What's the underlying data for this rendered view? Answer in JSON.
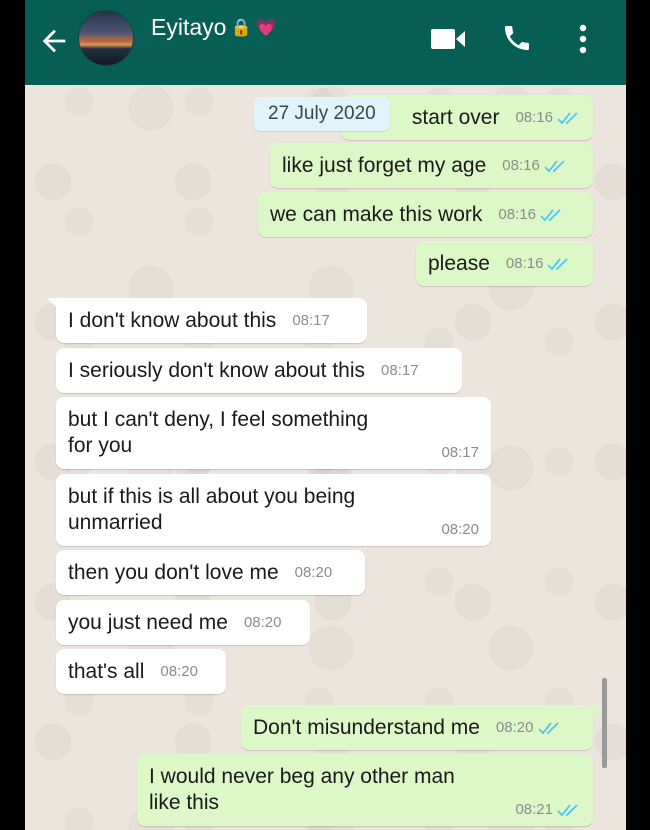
{
  "header": {
    "contact_name": "Eyitayo",
    "emoji_lock": "🔒",
    "emoji_heart": "💗"
  },
  "date_chip": "27 July 2020",
  "messages": [
    {
      "dir": "out",
      "text": "start over",
      "time": "08:16"
    },
    {
      "dir": "out",
      "text": "like just forget my age",
      "time": "08:16"
    },
    {
      "dir": "out",
      "text": "we can make this work",
      "time": "08:16"
    },
    {
      "dir": "out",
      "text": "please",
      "time": "08:16"
    },
    {
      "dir": "in",
      "text": "I don't know about this",
      "time": "08:17"
    },
    {
      "dir": "in",
      "text": "I seriously don't know about this",
      "time": "08:17"
    },
    {
      "dir": "in",
      "text": "but I can't deny, I feel something\nfor you",
      "time": "08:17"
    },
    {
      "dir": "in",
      "text": "but if this is all about you being\nunmarried",
      "time": "08:20"
    },
    {
      "dir": "in",
      "text": "then you don't love me",
      "time": "08:20"
    },
    {
      "dir": "in",
      "text": "you just need me",
      "time": "08:20"
    },
    {
      "dir": "in",
      "text": "that's all",
      "time": "08:20"
    },
    {
      "dir": "out",
      "text": "Don't misunderstand me",
      "time": "08:20"
    },
    {
      "dir": "out",
      "text": "I would never beg any other man\nlike this",
      "time": "08:21"
    }
  ],
  "icons": [
    "back-arrow-icon",
    "video-call-icon",
    "phone-call-icon",
    "more-options-icon",
    "double-tick-icon"
  ],
  "colors": {
    "header": "#075e54",
    "outgoing": "#dcf8c6",
    "incoming": "#ffffff",
    "ticks": "#4fc3f7",
    "background": "#ece5dd"
  }
}
